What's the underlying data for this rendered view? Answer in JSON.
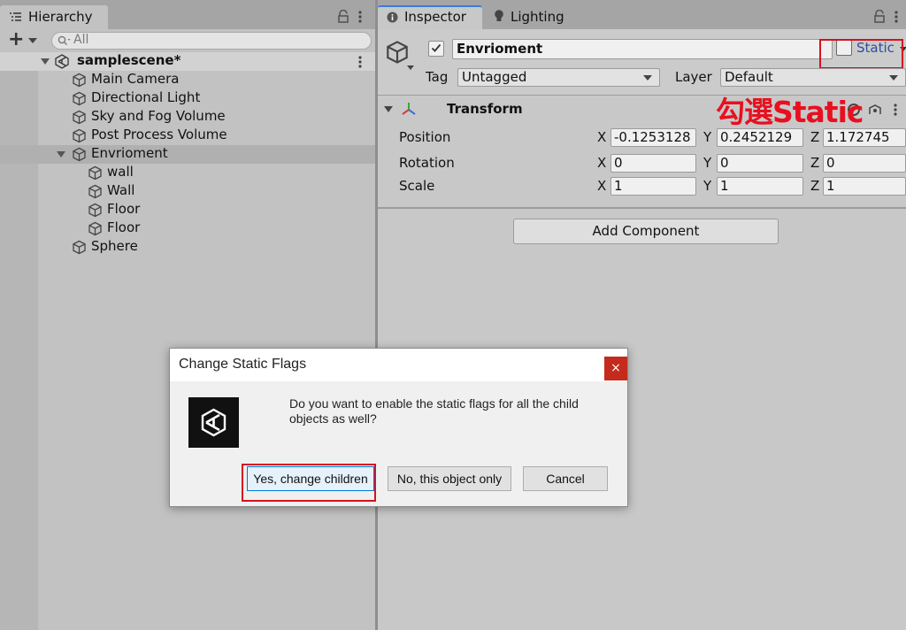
{
  "colors": {
    "accent": "#3a7cd8",
    "highlight": "#d8101f",
    "dialog_close": "#c42b1c"
  },
  "hierarchy": {
    "tab_label": "Hierarchy",
    "search_placeholder": "All",
    "scene_name": "samplescene*",
    "items": [
      {
        "label": "Main Camera"
      },
      {
        "label": "Directional Light"
      },
      {
        "label": "Sky and Fog Volume"
      },
      {
        "label": "Post Process Volume"
      },
      {
        "label": "Envrioment"
      },
      {
        "label": "wall"
      },
      {
        "label": "Wall"
      },
      {
        "label": "Floor"
      },
      {
        "label": "Floor"
      },
      {
        "label": "Sphere"
      }
    ]
  },
  "inspector": {
    "tabs": [
      {
        "label": "Inspector"
      },
      {
        "label": "Lighting"
      }
    ],
    "object_name": "Envrioment",
    "static_label": "Static",
    "tag_label": "Tag",
    "tag_value": "Untagged",
    "layer_label": "Layer",
    "layer_value": "Default",
    "annotation": "勾選Static",
    "transform": {
      "title": "Transform",
      "rows": [
        {
          "name": "Position",
          "x": "-0.1253128",
          "y": "0.2452129",
          "z": "1.172745"
        },
        {
          "name": "Rotation",
          "x": "0",
          "y": "0",
          "z": "0"
        },
        {
          "name": "Scale",
          "x": "1",
          "y": "1",
          "z": "1"
        }
      ],
      "axis_labels": {
        "x": "X",
        "y": "Y",
        "z": "Z"
      }
    },
    "add_component_label": "Add Component"
  },
  "dialog": {
    "title": "Change Static Flags",
    "close_glyph": "×",
    "message": "Do you want to enable the static flags for all the child objects as well?",
    "yes_label": "Yes, change children",
    "no_label": "No, this object only",
    "cancel_label": "Cancel"
  }
}
